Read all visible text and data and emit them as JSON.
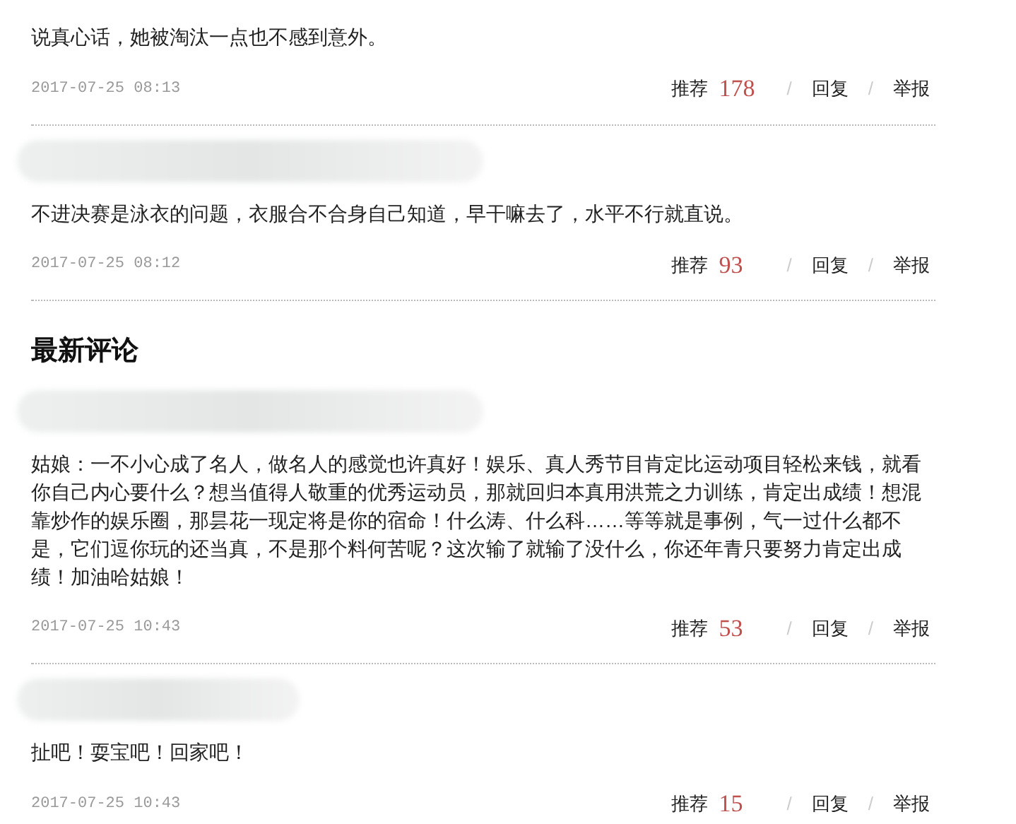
{
  "top_comments": [
    {
      "author_hidden": false,
      "text": "说真心话，她被淘汰一点也不感到意外。",
      "time": "2017-07-25 08:13",
      "recommend_label": "推荐",
      "recommend_count": "178",
      "separator_1": "/",
      "reply": "回复",
      "separator_2": "/",
      "report": "举报"
    },
    {
      "author_hidden": true,
      "text": "不进决赛是泳衣的问题，衣服合不合身自己知道，早干嘛去了，水平不行就直说。",
      "time": "2017-07-25 08:12",
      "recommend_label": "推荐",
      "recommend_count": "93",
      "separator_1": "/",
      "reply": "回复",
      "separator_2": "/",
      "report": "举报"
    }
  ],
  "latest_heading": "最新评论",
  "latest_comments": [
    {
      "author_hidden": true,
      "text": "姑娘：一不小心成了名人，做名人的感觉也许真好！娱乐、真人秀节目肯定比运动项目轻松来钱，就看你自己内心要什么？想当值得人敬重的优秀运动员，那就回归本真用洪荒之力训练，肯定出成绩！想混靠炒作的娱乐圈，那昙花一现定将是你的宿命！什么涛、什么科……等等就是事例，气一过什么都不是，它们逗你玩的还当真，不是那个料何苦呢？这次输了就输了没什么，你还年青只要努力肯定出成绩！加油哈姑娘！",
      "time": "2017-07-25 10:43",
      "recommend_label": "推荐",
      "recommend_count": "53",
      "separator_1": "/",
      "reply": "回复",
      "separator_2": "/",
      "report": "举报"
    },
    {
      "author_hidden": true,
      "text": "扯吧！耍宝吧！回家吧！",
      "time": "2017-07-25 10:43",
      "recommend_label": "推荐",
      "recommend_count": "15",
      "separator_1": "/",
      "reply": "回复",
      "separator_2": "/",
      "report": "举报"
    }
  ]
}
